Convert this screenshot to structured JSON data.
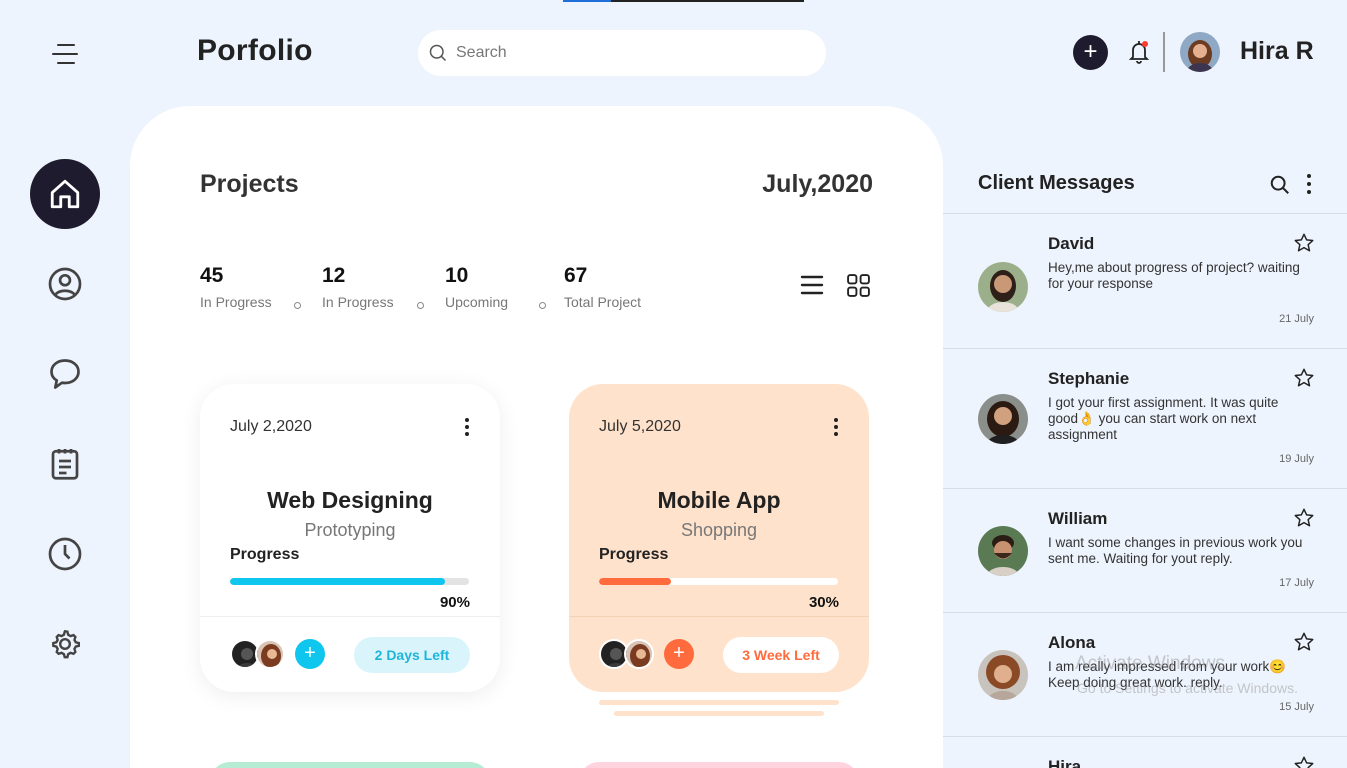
{
  "app": {
    "brand": "Porfolio"
  },
  "search": {
    "placeholder": "Search"
  },
  "user": {
    "name": "Hira R"
  },
  "icons": {
    "menu": "hamburger-icon",
    "search": "search-icon",
    "add": "plus-icon",
    "bell": "bell-icon",
    "home": "home-icon",
    "profile": "user-circle-icon",
    "chat": "chat-bubble-icon",
    "tasks": "clipboard-icon",
    "history": "clock-icon",
    "settings": "gear-icon"
  },
  "projects": {
    "title": "Projects",
    "date": "July,2020",
    "stats": [
      {
        "num": "45",
        "label": "In Progress"
      },
      {
        "num": "12",
        "label": "In Progress"
      },
      {
        "num": "10",
        "label": "Upcoming"
      },
      {
        "num": "67",
        "label": "Total Project"
      }
    ],
    "cards": [
      {
        "date": "July 2,2020",
        "title": "Web Designing",
        "subtitle": "Prototyping",
        "progress_label": "Progress",
        "progress": 0.9,
        "progress_text": "90%",
        "time_left": "2 Days Left",
        "accent": "#0ec6ee",
        "pill_bg": "#d9f5fb",
        "pill_color": "#1fb5db"
      },
      {
        "date": "July 5,2020",
        "title": "Mobile App",
        "subtitle": "Shopping",
        "progress_label": "Progress",
        "progress": 0.3,
        "progress_text": "30%",
        "time_left": "3 Week Left",
        "accent": "#ff6b3d",
        "pill_bg": "#ffffff",
        "pill_color": "#ff6b3d"
      }
    ]
  },
  "messages": {
    "title": "Client Messages",
    "items": [
      {
        "name": "David",
        "text": "Hey,me about progress of project? waiting for your response",
        "date": "21 July"
      },
      {
        "name": "Stephanie",
        "text": "I got your first assignment. It was quite good👌 you can start work on next assignment",
        "date": "19 July"
      },
      {
        "name": "William",
        "text": "I want some changes in previous work you sent me. Waiting for yout reply.",
        "date": "17 July"
      },
      {
        "name": "Alona",
        "text": "I am really impressed from your work😊 Keep doing great work. reply.",
        "date": "15 July"
      },
      {
        "name": "Hira",
        "text": "",
        "date": ""
      }
    ]
  },
  "watermark": {
    "line1": "Activate Windows",
    "line2": "Go to Settings to activate Windows."
  }
}
